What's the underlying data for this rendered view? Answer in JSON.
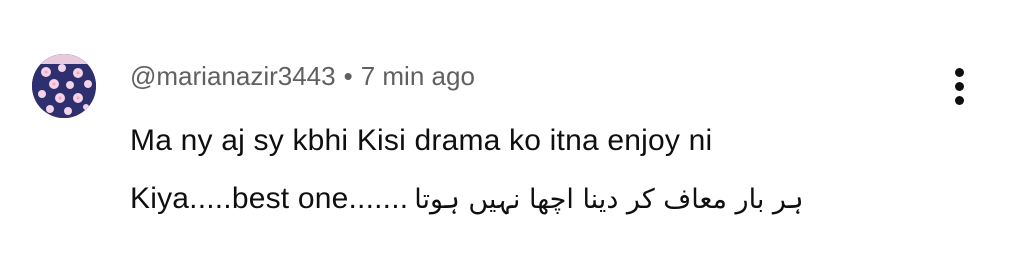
{
  "comment": {
    "author": "@marianazir3443",
    "separator": "•",
    "time": "7 min ago",
    "text_line1": "Ma ny aj sy kbhi Kisi drama ko itna enjoy ni",
    "text_line2": "Kiya.....best one.......",
    "text_urdu": "ہر بار معاف کر دینا اچھا نہیں ہوتا",
    "menu_icon": "more-vert-icon",
    "avatar_icon": "flowers-avatar"
  },
  "colors": {
    "text": "#0f0f0f",
    "meta": "#606060",
    "avatar_bg": "#2d2f6e",
    "avatar_flower": "#f3d3e6"
  }
}
